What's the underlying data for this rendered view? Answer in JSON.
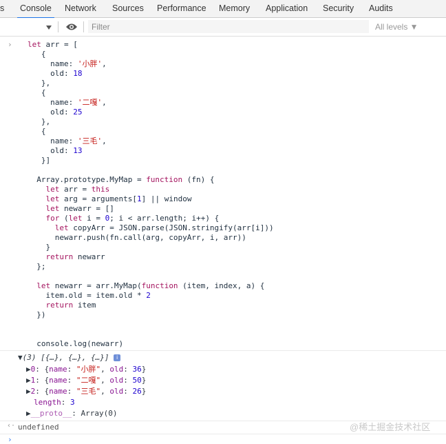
{
  "tabs": [
    {
      "label": "s",
      "active": false
    },
    {
      "label": "Console",
      "active": true
    },
    {
      "label": "Network",
      "active": false
    },
    {
      "label": "Sources",
      "active": false
    },
    {
      "label": "Performance",
      "active": false
    },
    {
      "label": "Memory",
      "active": false
    },
    {
      "label": "Application",
      "active": false
    },
    {
      "label": "Security",
      "active": false
    },
    {
      "label": "Audits",
      "active": false
    }
  ],
  "toolbar": {
    "filter_placeholder": "Filter",
    "levels_label": "All levels ▼"
  },
  "input_code": "let arr = [\n   {\n     name: '小胖',\n     old: 18\n   },\n   {\n     name: '二嘎',\n     old: 25\n   },\n   {\n     name: '三毛',\n     old: 13\n   }]\n\n  Array.prototype.MyMap = function (fn) {\n    let arr = this\n    let arg = arguments[1] || window\n    let newarr = []\n    for (let i = 0; i < arr.length; i++) {\n      let copyArr = JSON.parse(JSON.stringify(arr[i]))\n      newarr.push(fn.call(arg, copyArr, i, arr))\n    }\n    return newarr\n  };\n\n  let newarr = arr.MyMap(function (item, index, a) {\n    item.old = item.old * 2\n    return item\n  })\n\n\n  console.log(newarr)",
  "output": {
    "summary": "(3) [{…}, {…}, {…}]",
    "items": [
      {
        "index": "0",
        "name": "\"小胖\"",
        "old": "36"
      },
      {
        "index": "1",
        "name": "\"二嘎\"",
        "old": "50"
      },
      {
        "index": "2",
        "name": "\"三毛\"",
        "old": "26"
      }
    ],
    "length_key": "length",
    "length_value": "3",
    "proto_key": "__proto__",
    "proto_value": "Array(0)"
  },
  "return_value": "undefined",
  "watermark": "@稀土掘金技术社区"
}
